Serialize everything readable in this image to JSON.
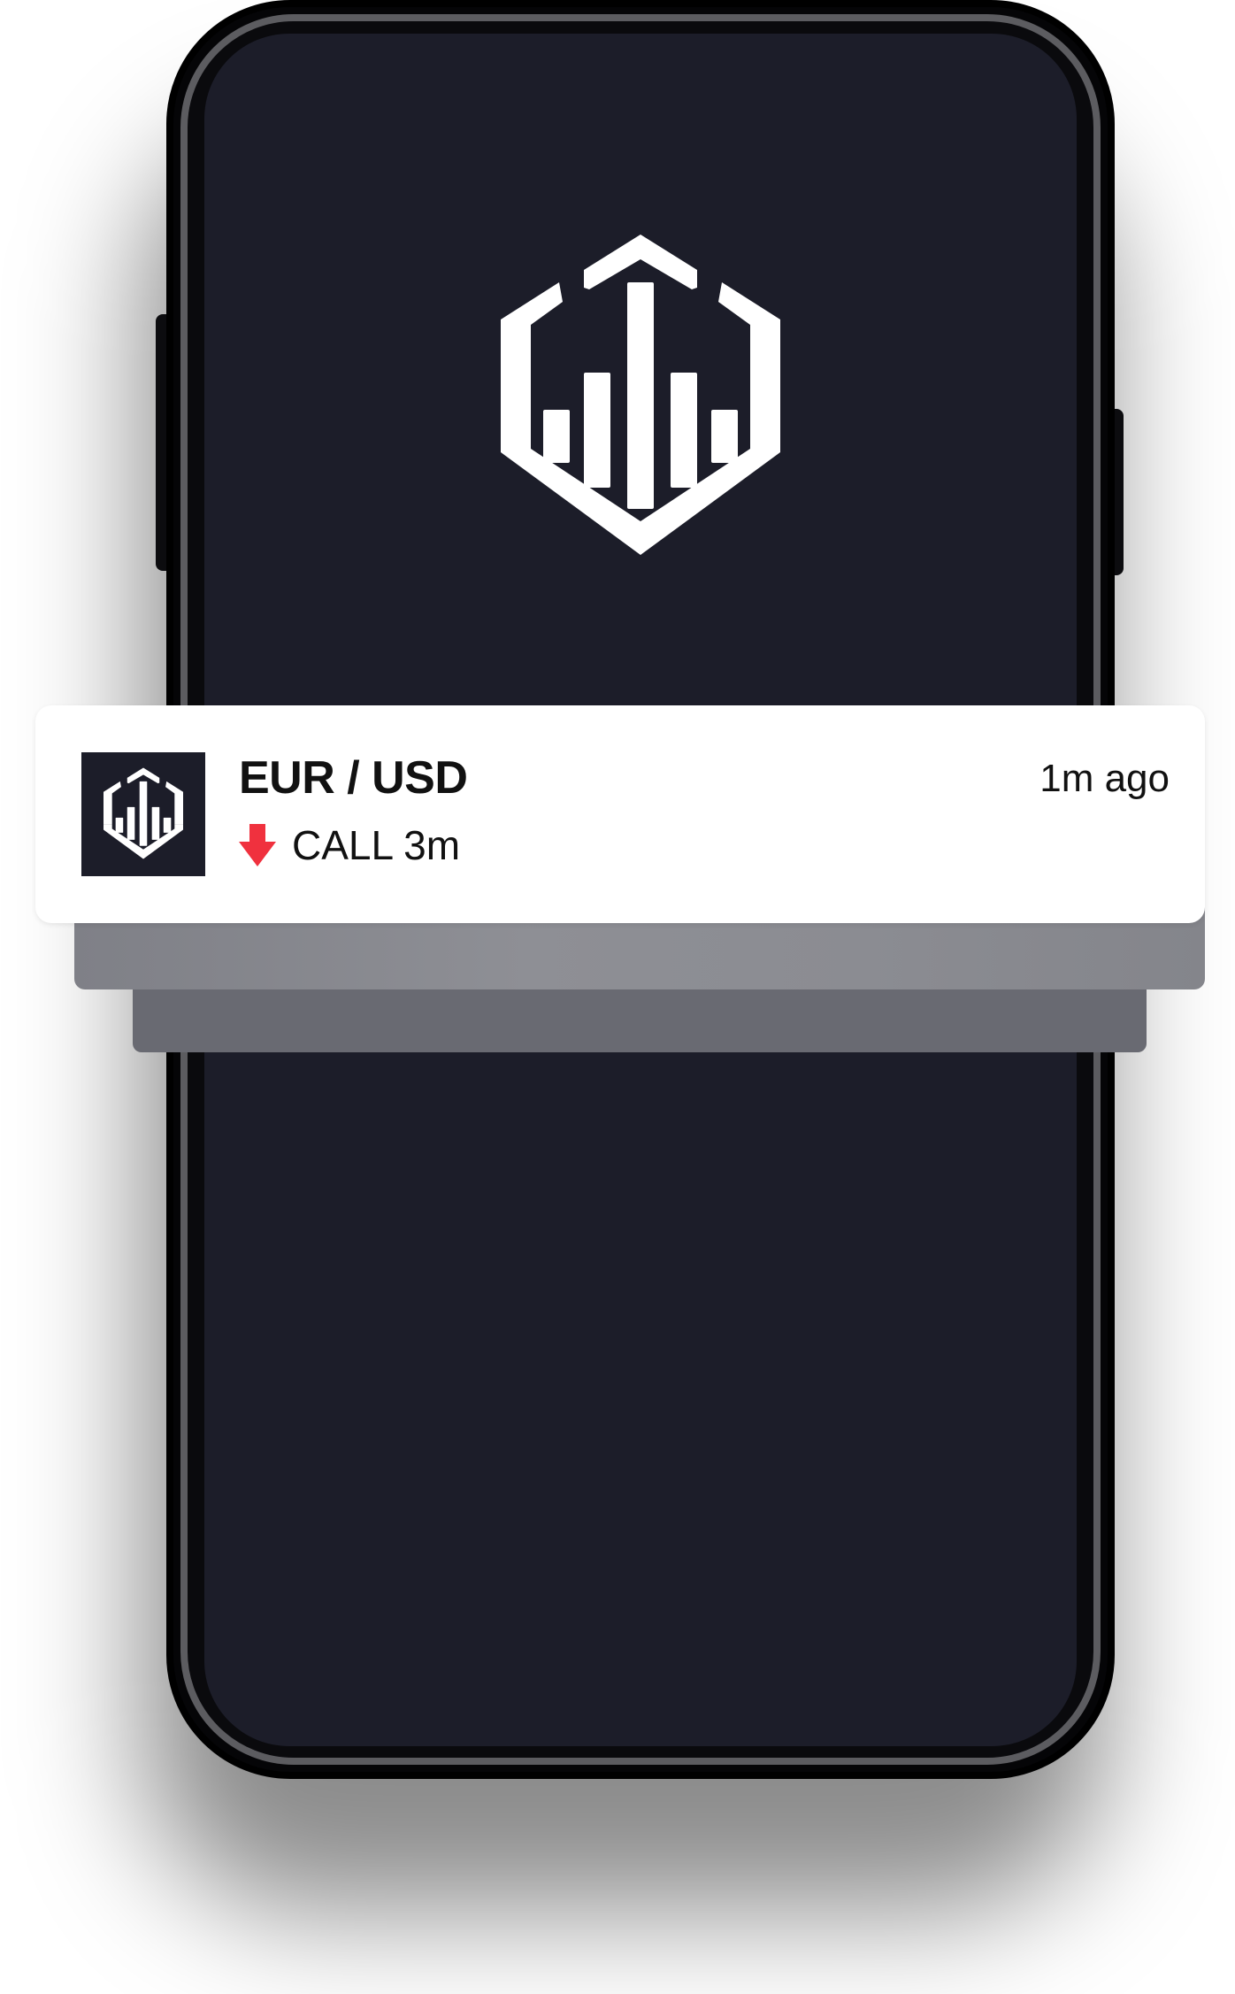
{
  "notification": {
    "title": "EUR / USD",
    "time": "1m ago",
    "direction_icon": "arrow-down-icon",
    "body": "CALL 3m"
  },
  "icons": {
    "app_logo": "hexagon-chart-logo",
    "notification_app_icon": "hexagon-chart-logo"
  },
  "colors": {
    "screen_background": "#1c1d29",
    "notification_background": "#ffffff",
    "arrow_down": "#f0313e",
    "logo": "#ffffff"
  }
}
